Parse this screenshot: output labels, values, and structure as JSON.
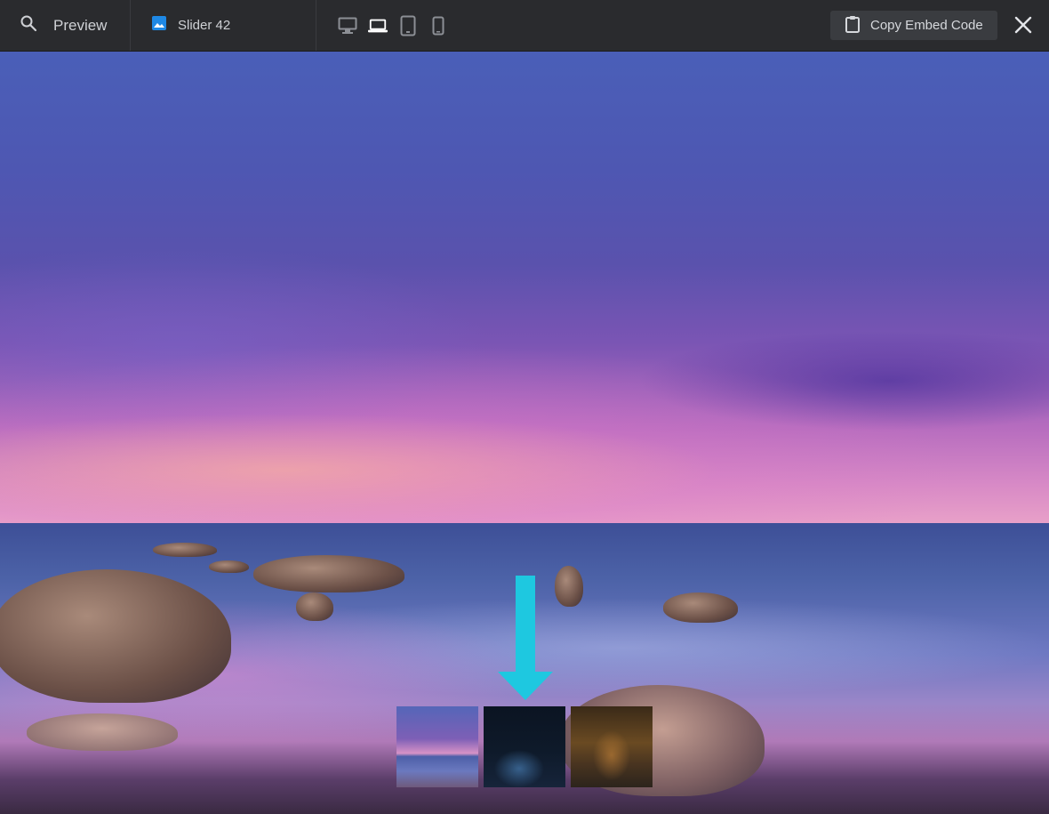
{
  "topbar": {
    "search_icon": "search-icon",
    "preview_label": "Preview",
    "slider_icon": "image-icon",
    "slider_name": "Slider 42",
    "devices": [
      "desktop-icon",
      "laptop-icon",
      "tablet-icon",
      "mobile-icon"
    ],
    "active_device": "laptop",
    "copy_button_label": "Copy Embed Code",
    "copy_icon": "clipboard-icon",
    "close_icon": "close-icon"
  },
  "slider": {
    "slides": [
      {
        "thumb": "sunset-sea"
      },
      {
        "thumb": "city-night"
      },
      {
        "thumb": "forest-road"
      }
    ],
    "accent_color": "#1ec8e0"
  }
}
